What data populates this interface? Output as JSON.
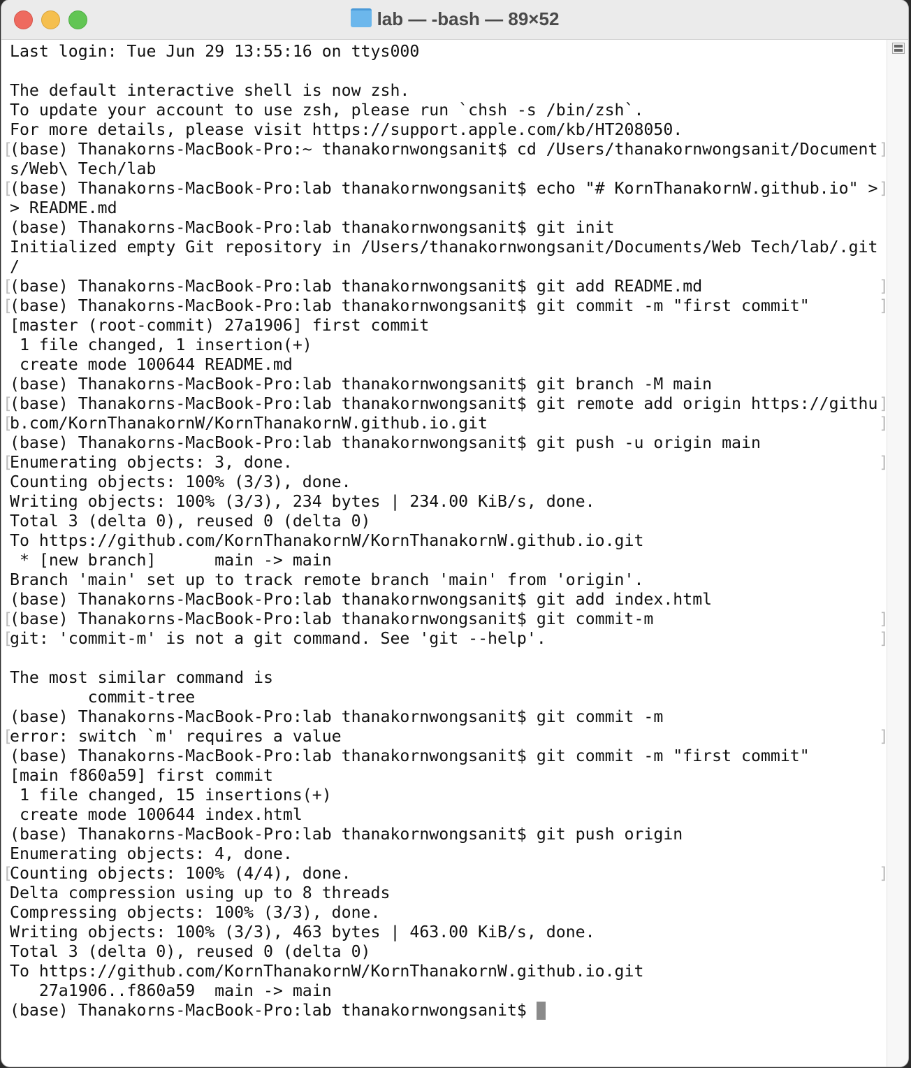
{
  "window": {
    "title": "lab — -bash — 89×52"
  },
  "terminal": {
    "lines": [
      {
        "text": "Last login: Tue Jun 29 13:55:16 on ttys000"
      },
      {
        "text": ""
      },
      {
        "text": "The default interactive shell is now zsh."
      },
      {
        "text": "To update your account to use zsh, please run `chsh -s /bin/zsh`."
      },
      {
        "text": "For more details, please visit https://support.apple.com/kb/HT208050."
      },
      {
        "text": "(base) Thanakorns-MacBook-Pro:~ thanakornwongsanit$ cd /Users/thanakornwongsanit/Document",
        "marked": true
      },
      {
        "text": "s/Web\\ Tech/lab"
      },
      {
        "text": "(base) Thanakorns-MacBook-Pro:lab thanakornwongsanit$ echo \"# KornThanakornW.github.io\" >",
        "marked": true
      },
      {
        "text": "> README.md"
      },
      {
        "text": "(base) Thanakorns-MacBook-Pro:lab thanakornwongsanit$ git init"
      },
      {
        "text": "Initialized empty Git repository in /Users/thanakornwongsanit/Documents/Web Tech/lab/.git"
      },
      {
        "text": "/"
      },
      {
        "text": "(base) Thanakorns-MacBook-Pro:lab thanakornwongsanit$ git add README.md",
        "marked": true
      },
      {
        "text": "(base) Thanakorns-MacBook-Pro:lab thanakornwongsanit$ git commit -m \"first commit\"",
        "marked": true
      },
      {
        "text": "[master (root-commit) 27a1906] first commit"
      },
      {
        "text": " 1 file changed, 1 insertion(+)"
      },
      {
        "text": " create mode 100644 README.md"
      },
      {
        "text": "(base) Thanakorns-MacBook-Pro:lab thanakornwongsanit$ git branch -M main"
      },
      {
        "text": "(base) Thanakorns-MacBook-Pro:lab thanakornwongsanit$ git remote add origin https://githu",
        "marked": true
      },
      {
        "text": "b.com/KornThanakornW/KornThanakornW.github.io.git",
        "marked": true
      },
      {
        "text": "(base) Thanakorns-MacBook-Pro:lab thanakornwongsanit$ git push -u origin main"
      },
      {
        "text": "Enumerating objects: 3, done.",
        "marked": true
      },
      {
        "text": "Counting objects: 100% (3/3), done."
      },
      {
        "text": "Writing objects: 100% (3/3), 234 bytes | 234.00 KiB/s, done."
      },
      {
        "text": "Total 3 (delta 0), reused 0 (delta 0)"
      },
      {
        "text": "To https://github.com/KornThanakornW/KornThanakornW.github.io.git"
      },
      {
        "text": " * [new branch]      main -> main"
      },
      {
        "text": "Branch 'main' set up to track remote branch 'main' from 'origin'."
      },
      {
        "text": "(base) Thanakorns-MacBook-Pro:lab thanakornwongsanit$ git add index.html"
      },
      {
        "text": "(base) Thanakorns-MacBook-Pro:lab thanakornwongsanit$ git commit-m",
        "marked": true
      },
      {
        "text": "git: 'commit-m' is not a git command. See 'git --help'.",
        "marked": true
      },
      {
        "text": ""
      },
      {
        "text": "The most similar command is"
      },
      {
        "text": "        commit-tree"
      },
      {
        "text": "(base) Thanakorns-MacBook-Pro:lab thanakornwongsanit$ git commit -m"
      },
      {
        "text": "error: switch `m' requires a value",
        "marked": true
      },
      {
        "text": "(base) Thanakorns-MacBook-Pro:lab thanakornwongsanit$ git commit -m \"first commit\""
      },
      {
        "text": "[main f860a59] first commit"
      },
      {
        "text": " 1 file changed, 15 insertions(+)"
      },
      {
        "text": " create mode 100644 index.html"
      },
      {
        "text": "(base) Thanakorns-MacBook-Pro:lab thanakornwongsanit$ git push origin"
      },
      {
        "text": "Enumerating objects: 4, done."
      },
      {
        "text": "Counting objects: 100% (4/4), done.",
        "marked": true
      },
      {
        "text": "Delta compression using up to 8 threads"
      },
      {
        "text": "Compressing objects: 100% (3/3), done."
      },
      {
        "text": "Writing objects: 100% (3/3), 463 bytes | 463.00 KiB/s, done."
      },
      {
        "text": "Total 3 (delta 0), reused 0 (delta 0)"
      },
      {
        "text": "To https://github.com/KornThanakornW/KornThanakornW.github.io.git"
      },
      {
        "text": "   27a1906..f860a59  main -> main"
      }
    ],
    "prompt": "(base) Thanakorns-MacBook-Pro:lab thanakornwongsanit$ "
  }
}
